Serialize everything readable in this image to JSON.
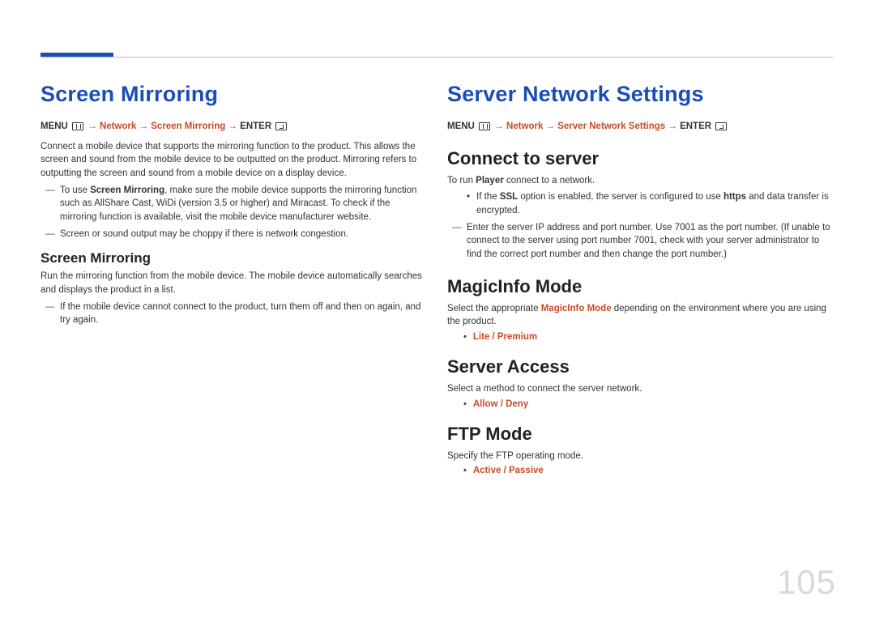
{
  "page_number": "105",
  "left": {
    "h1": "Screen Mirroring",
    "menu_prefix": "MENU",
    "menu_path_mid": " → Network → Screen Mirroring → ",
    "menu_suffix": "ENTER",
    "intro": "Connect a mobile device that supports the mirroring function to the product. This allows the screen and sound from the mobile device to be outputted on the product. Mirroring refers to outputting the screen and sound from a mobile device on a display device.",
    "note1_pre": "To use ",
    "note1_bold": "Screen Mirroring",
    "note1_post": ", make sure the mobile device supports the mirroring function such as AllShare Cast, WiDi (version 3.5 or higher) and Miracast. To check if the mirroring function is available, visit the mobile device manufacturer website.",
    "note2": "Screen or sound output may be choppy if there is network congestion.",
    "h3": "Screen Mirroring",
    "sub_intro": "Run the mirroring function from the mobile device. The mobile device automatically searches and displays the product in a list.",
    "note3": "If the mobile device cannot connect to the product, turn them off and then on again, and try again."
  },
  "right": {
    "h1": "Server Network Settings",
    "menu_prefix": "MENU",
    "menu_path_mid": " → Network → Server Network Settings → ",
    "menu_suffix": "ENTER",
    "connect": {
      "h2": "Connect to server",
      "p_pre": "To run ",
      "p_bold": "Player",
      "p_post": " connect to a network.",
      "bullet_pre": "If the ",
      "bullet_bold": "SSL",
      "bullet_post": " option is enabled, the server is configured to use ",
      "bullet_bold2": "https",
      "bullet_tail": " and data transfer is encrypted.",
      "note": "Enter the server IP address and port number. Use 7001 as the port number. (If unable to connect to the server using port number 7001, check with your server administrator to find the correct port number and then change the port number.)"
    },
    "magic": {
      "h2": "MagicInfo Mode",
      "p_pre": "Select the appropriate ",
      "p_bold": "MagicInfo Mode",
      "p_post": " depending on the environment where you are using the product.",
      "opt": "Lite / Premium"
    },
    "access": {
      "h2": "Server Access",
      "p": "Select a method to connect the server network.",
      "opt": "Allow / Deny"
    },
    "ftp": {
      "h2": "FTP Mode",
      "p": "Specify the FTP operating mode.",
      "opt": "Active / Passive"
    }
  }
}
